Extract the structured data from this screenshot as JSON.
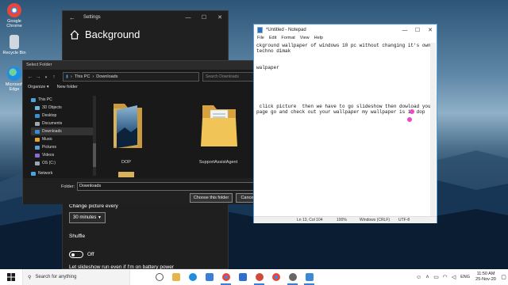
{
  "desktop": {
    "icons": [
      {
        "label": "Google Chrome",
        "color": "#e8463b"
      },
      {
        "label": "Recycle Bin",
        "color": "#cfd8e0"
      },
      {
        "label": "Microsoft Edge",
        "color": "#1f8de0"
      }
    ]
  },
  "settings": {
    "title": "Settings",
    "heading": "Background",
    "change_label": "Change picture every",
    "interval_value": "30 minutes",
    "shuffle_label": "Shuffle",
    "shuffle_state": "Off",
    "battery_label": "Let slideshow run even if I'm on battery power"
  },
  "dialog": {
    "title": "Select Folder",
    "path": [
      "This PC",
      "Downloads"
    ],
    "search_placeholder": "Search Downloads",
    "organize": "Organize ▾",
    "new_folder": "New folder",
    "nav_items": [
      {
        "label": "This PC",
        "color": "#4aa3df"
      },
      {
        "label": "3D Objects",
        "color": "#6fb6e0"
      },
      {
        "label": "Desktop",
        "color": "#3b8fd0"
      },
      {
        "label": "Documents",
        "color": "#9aa7b3"
      },
      {
        "label": "Downloads",
        "color": "#3a8ad6"
      },
      {
        "label": "Music",
        "color": "#e3a23a"
      },
      {
        "label": "Pictures",
        "color": "#5aa0d8"
      },
      {
        "label": "Videos",
        "color": "#8a6ad0"
      },
      {
        "label": "OS (C:)",
        "color": "#9aa7b3"
      },
      {
        "label": "Network",
        "color": "#4aa3df"
      }
    ],
    "folders": [
      {
        "name": "DOP"
      },
      {
        "name": "SupportAssistAgent"
      }
    ],
    "folder_label": "Folder:",
    "folder_value": "Downloads",
    "choose_button": "Choose this folder",
    "cancel_button": "Cancel"
  },
  "notepad": {
    "title": "*Untitled - Notepad",
    "menu": [
      "File",
      "Edit",
      "Format",
      "View",
      "Help"
    ],
    "lines": [
      "ckground wallpaper of windows 10 pc without changing it's own wal",
      "techno dimak",
      "",
      "",
      "walpaper",
      "",
      "",
      "",
      "",
      "",
      "",
      " click picture  then we have to go slideshow then dowload your fav",
      "page go and check out your wallpaper my wallpaper is in dop",
      ""
    ],
    "status_pos": "Ln 13, Col 104",
    "status_zoom": "100%",
    "status_eol": "Windows (CRLF)",
    "status_enc": "UTF-8"
  },
  "taskbar": {
    "search_placeholder": "Search for anything",
    "apps": [
      {
        "name": "task-view",
        "color": "#555555"
      },
      {
        "name": "file-explorer",
        "color": "#e8b54a"
      },
      {
        "name": "edge",
        "color": "#1f8de0"
      },
      {
        "name": "store",
        "color": "#3a7fd5"
      },
      {
        "name": "chrome",
        "color": "#e8463b"
      },
      {
        "name": "photos",
        "color": "#2e6fd0"
      },
      {
        "name": "media",
        "color": "#d04a3a"
      },
      {
        "name": "chrome-2",
        "color": "#e8463b"
      },
      {
        "name": "settings",
        "color": "#666666"
      },
      {
        "name": "notepad",
        "color": "#3a8ad6"
      }
    ],
    "lang": "ENG",
    "time": "11:50 AM",
    "date": "25-Nov-20"
  }
}
